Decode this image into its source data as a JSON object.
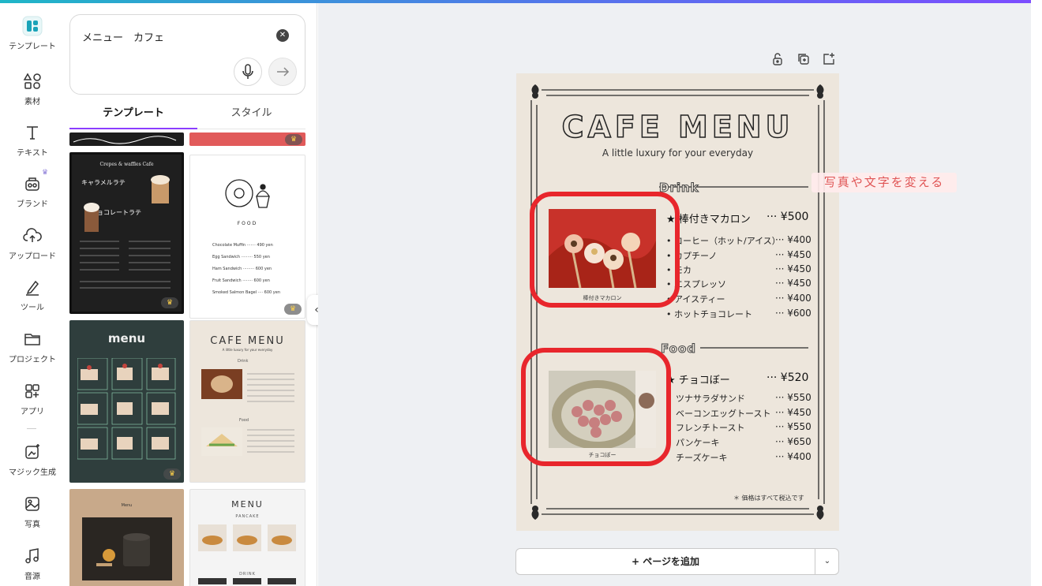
{
  "rail": {
    "items": [
      {
        "label": "テンプレート",
        "icon": "template-icon"
      },
      {
        "label": "素材",
        "icon": "elements-icon"
      },
      {
        "label": "テキスト",
        "icon": "text-icon"
      },
      {
        "label": "ブランド",
        "icon": "brand-icon"
      },
      {
        "label": "アップロード",
        "icon": "upload-icon"
      },
      {
        "label": "ツール",
        "icon": "draw-icon"
      },
      {
        "label": "プロジェクト",
        "icon": "folder-icon"
      },
      {
        "label": "アプリ",
        "icon": "apps-icon"
      },
      {
        "label": "マジック生成",
        "icon": "magic-icon"
      },
      {
        "label": "写真",
        "icon": "photo-icon"
      },
      {
        "label": "音源",
        "icon": "music-icon"
      }
    ]
  },
  "search": {
    "value": "メニュー　カフェ"
  },
  "tabs": {
    "template": "テンプレート",
    "style": "スタイル"
  },
  "thumbs": {
    "t1": {
      "title": "Crepes & waffles Cafe",
      "l1": "キャラメルラテ",
      "l2": "チョコレートラテ"
    },
    "t2": {
      "title": "FOOD",
      "rows": [
        "Chocolate Muffin ······· 490 yen",
        "Egg Sandwich ········· 550 yen",
        "Ham Sandwich ········· 600 yen",
        "Fruit Sandwich ········ 600 yen",
        "Smoked Salmon Bagel ···· 600 yen"
      ]
    },
    "t3": {
      "title": "menu"
    },
    "t4": {
      "title": "CAFE MENU",
      "sub": "A little luxury for your everyday",
      "s1": "Drink",
      "s2": "Food"
    },
    "t5": {
      "title": "Menu"
    },
    "t6": {
      "title": "MENU",
      "s1": "PANCAKE",
      "s2": "DRINK"
    }
  },
  "menu": {
    "title": "CAFE MENU",
    "subtitle": "A little luxury for your everyday",
    "drink_heading": "Drink",
    "food_heading": "Food",
    "drink_caption": "棒付きマカロン",
    "food_caption": "チョコぼー",
    "drink_featured": {
      "name": "★ 棒付きマカロン",
      "price": "··· ¥500"
    },
    "drink_items": [
      {
        "name": "• コーヒー（ホット/アイス）",
        "price": "··· ¥400"
      },
      {
        "name": "• カプチーノ",
        "price": "··· ¥450"
      },
      {
        "name": "• モカ",
        "price": "··· ¥450"
      },
      {
        "name": "• エスプレッソ",
        "price": "··· ¥450"
      },
      {
        "name": "• アイスティー",
        "price": "··· ¥400"
      },
      {
        "name": "• ホットチョコレート",
        "price": "··· ¥600"
      }
    ],
    "food_featured": {
      "name": "★ チョコぼー",
      "price": "··· ¥520"
    },
    "food_items": [
      {
        "name": "ツナサラダサンド",
        "price": "··· ¥550"
      },
      {
        "name": "ベーコンエッグトースト",
        "price": "··· ¥450"
      },
      {
        "name": "フレンチトースト",
        "price": "··· ¥550"
      },
      {
        "name": "パンケーキ",
        "price": "··· ¥650"
      },
      {
        "name": "チーズケーキ",
        "price": "··· ¥400"
      }
    ],
    "note": "＊ 価格はすべて税込です"
  },
  "callout": "写真や文字を変える",
  "add_page": {
    "label": "+ ページを追加"
  },
  "colors": {
    "accent": "#8b3dff",
    "highlight": "#e8262c",
    "paper": "#ede6dc"
  }
}
